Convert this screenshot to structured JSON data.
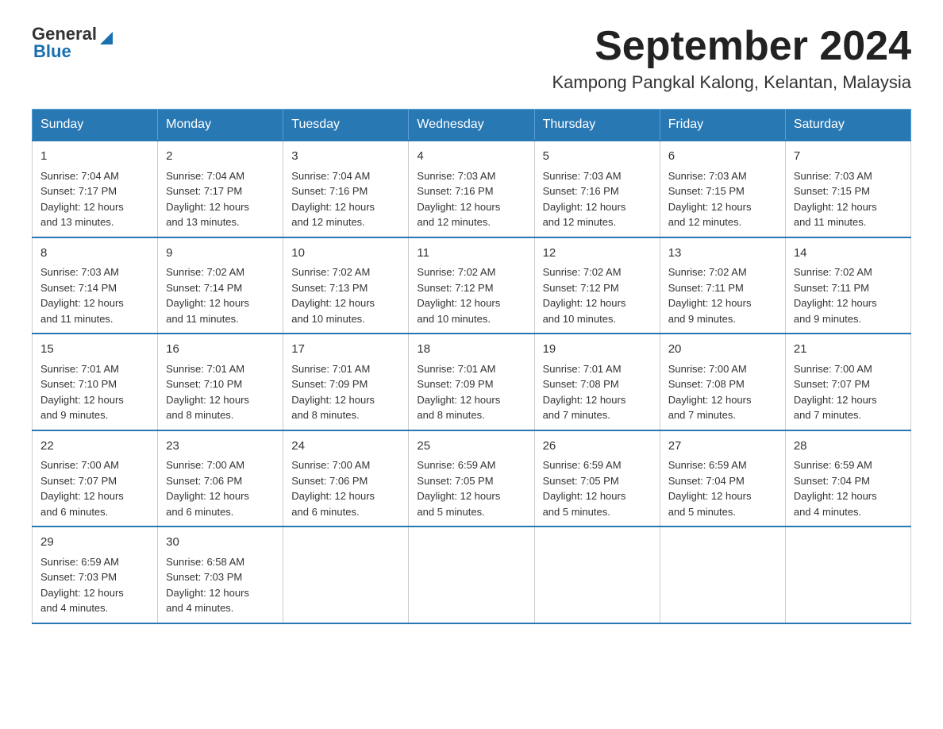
{
  "header": {
    "logo_general": "General",
    "logo_blue": "Blue",
    "month_title": "September 2024",
    "subtitle": "Kampong Pangkal Kalong, Kelantan, Malaysia"
  },
  "days_of_week": [
    "Sunday",
    "Monday",
    "Tuesday",
    "Wednesday",
    "Thursday",
    "Friday",
    "Saturday"
  ],
  "weeks": [
    [
      {
        "day": "1",
        "sunrise": "7:04 AM",
        "sunset": "7:17 PM",
        "daylight": "12 hours and 13 minutes."
      },
      {
        "day": "2",
        "sunrise": "7:04 AM",
        "sunset": "7:17 PM",
        "daylight": "12 hours and 13 minutes."
      },
      {
        "day": "3",
        "sunrise": "7:04 AM",
        "sunset": "7:16 PM",
        "daylight": "12 hours and 12 minutes."
      },
      {
        "day": "4",
        "sunrise": "7:03 AM",
        "sunset": "7:16 PM",
        "daylight": "12 hours and 12 minutes."
      },
      {
        "day": "5",
        "sunrise": "7:03 AM",
        "sunset": "7:16 PM",
        "daylight": "12 hours and 12 minutes."
      },
      {
        "day": "6",
        "sunrise": "7:03 AM",
        "sunset": "7:15 PM",
        "daylight": "12 hours and 12 minutes."
      },
      {
        "day": "7",
        "sunrise": "7:03 AM",
        "sunset": "7:15 PM",
        "daylight": "12 hours and 11 minutes."
      }
    ],
    [
      {
        "day": "8",
        "sunrise": "7:03 AM",
        "sunset": "7:14 PM",
        "daylight": "12 hours and 11 minutes."
      },
      {
        "day": "9",
        "sunrise": "7:02 AM",
        "sunset": "7:14 PM",
        "daylight": "12 hours and 11 minutes."
      },
      {
        "day": "10",
        "sunrise": "7:02 AM",
        "sunset": "7:13 PM",
        "daylight": "12 hours and 10 minutes."
      },
      {
        "day": "11",
        "sunrise": "7:02 AM",
        "sunset": "7:12 PM",
        "daylight": "12 hours and 10 minutes."
      },
      {
        "day": "12",
        "sunrise": "7:02 AM",
        "sunset": "7:12 PM",
        "daylight": "12 hours and 10 minutes."
      },
      {
        "day": "13",
        "sunrise": "7:02 AM",
        "sunset": "7:11 PM",
        "daylight": "12 hours and 9 minutes."
      },
      {
        "day": "14",
        "sunrise": "7:02 AM",
        "sunset": "7:11 PM",
        "daylight": "12 hours and 9 minutes."
      }
    ],
    [
      {
        "day": "15",
        "sunrise": "7:01 AM",
        "sunset": "7:10 PM",
        "daylight": "12 hours and 9 minutes."
      },
      {
        "day": "16",
        "sunrise": "7:01 AM",
        "sunset": "7:10 PM",
        "daylight": "12 hours and 8 minutes."
      },
      {
        "day": "17",
        "sunrise": "7:01 AM",
        "sunset": "7:09 PM",
        "daylight": "12 hours and 8 minutes."
      },
      {
        "day": "18",
        "sunrise": "7:01 AM",
        "sunset": "7:09 PM",
        "daylight": "12 hours and 8 minutes."
      },
      {
        "day": "19",
        "sunrise": "7:01 AM",
        "sunset": "7:08 PM",
        "daylight": "12 hours and 7 minutes."
      },
      {
        "day": "20",
        "sunrise": "7:00 AM",
        "sunset": "7:08 PM",
        "daylight": "12 hours and 7 minutes."
      },
      {
        "day": "21",
        "sunrise": "7:00 AM",
        "sunset": "7:07 PM",
        "daylight": "12 hours and 7 minutes."
      }
    ],
    [
      {
        "day": "22",
        "sunrise": "7:00 AM",
        "sunset": "7:07 PM",
        "daylight": "12 hours and 6 minutes."
      },
      {
        "day": "23",
        "sunrise": "7:00 AM",
        "sunset": "7:06 PM",
        "daylight": "12 hours and 6 minutes."
      },
      {
        "day": "24",
        "sunrise": "7:00 AM",
        "sunset": "7:06 PM",
        "daylight": "12 hours and 6 minutes."
      },
      {
        "day": "25",
        "sunrise": "6:59 AM",
        "sunset": "7:05 PM",
        "daylight": "12 hours and 5 minutes."
      },
      {
        "day": "26",
        "sunrise": "6:59 AM",
        "sunset": "7:05 PM",
        "daylight": "12 hours and 5 minutes."
      },
      {
        "day": "27",
        "sunrise": "6:59 AM",
        "sunset": "7:04 PM",
        "daylight": "12 hours and 5 minutes."
      },
      {
        "day": "28",
        "sunrise": "6:59 AM",
        "sunset": "7:04 PM",
        "daylight": "12 hours and 4 minutes."
      }
    ],
    [
      {
        "day": "29",
        "sunrise": "6:59 AM",
        "sunset": "7:03 PM",
        "daylight": "12 hours and 4 minutes."
      },
      {
        "day": "30",
        "sunrise": "6:58 AM",
        "sunset": "7:03 PM",
        "daylight": "12 hours and 4 minutes."
      },
      null,
      null,
      null,
      null,
      null
    ]
  ],
  "labels": {
    "sunrise": "Sunrise:",
    "sunset": "Sunset:",
    "daylight": "Daylight:"
  }
}
